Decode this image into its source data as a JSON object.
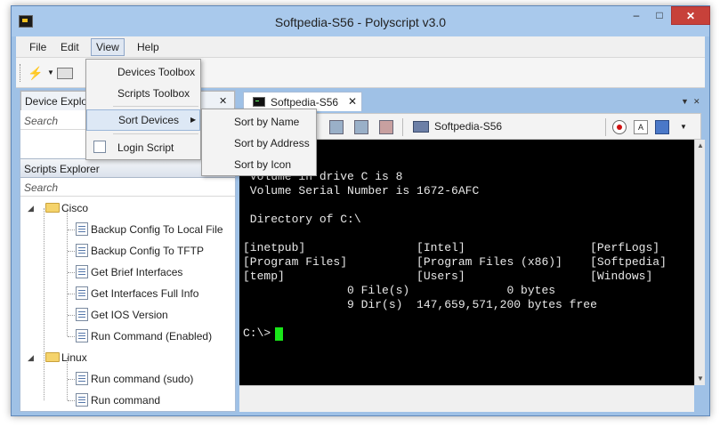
{
  "window": {
    "title": "Softpedia-S56 - Polyscript v3.0",
    "min_glyph": "–",
    "max_glyph": "□",
    "close_glyph": "✕"
  },
  "menu": {
    "items": [
      "File",
      "Edit",
      "View",
      "Help"
    ],
    "active": "View"
  },
  "view_menu": {
    "items": [
      "Devices Toolbox",
      "Scripts Toolbox",
      "Sort Devices",
      "Login Script"
    ],
    "highlighted": "Sort Devices"
  },
  "sort_submenu": {
    "items": [
      "Sort by Name",
      "Sort by Address",
      "Sort by Icon"
    ]
  },
  "device_explorer": {
    "tab_label": "Device Explor",
    "search_placeholder": "Search"
  },
  "scripts_explorer": {
    "header": "Scripts Explorer",
    "search_placeholder": "Search",
    "folders": [
      {
        "name": "Cisco",
        "scripts": [
          "Backup Config To Local File",
          "Backup Config To TFTP",
          "Get Brief Interfaces",
          "Get Interfaces Full Info",
          "Get IOS Version",
          "Run Command (Enabled)"
        ]
      },
      {
        "name": "Linux",
        "scripts": [
          "Run command (sudo)",
          "Run command"
        ]
      }
    ]
  },
  "document_tab": {
    "label": "Softpedia-S56",
    "close": "✕"
  },
  "session_toolbar": {
    "host": "Softpedia-S56"
  },
  "console": {
    "lines": [
      " Volume in drive C is 8",
      " Volume Serial Number is 1672-6AFC",
      "",
      " Directory of C:\\",
      "",
      "[inetpub]                [Intel]                  [PerfLogs]",
      "[Program Files]          [Program Files (x86)]    [Softpedia]",
      "[temp]                   [Users]                  [Windows]",
      "               0 File(s)              0 bytes",
      "               9 Dir(s)  147,659,571,200 bytes free",
      "",
      "C:\\>"
    ]
  },
  "colors": {
    "frame": "#9fc1e6",
    "console_bg": "#000000",
    "console_fg": "#e8e8e8",
    "cursor": "#19e619",
    "close_red": "#c7413a"
  }
}
